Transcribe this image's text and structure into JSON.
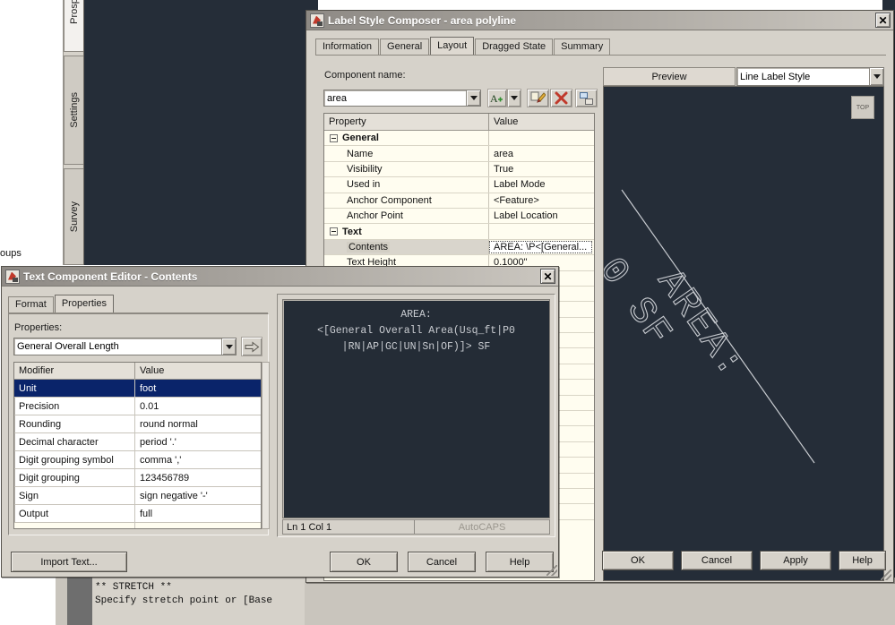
{
  "background": {
    "sidebar_tabs": [
      "Prospe",
      "Settings",
      "Survey"
    ],
    "groups_label": "oups",
    "command_lines": [
      "** STRETCH **",
      "Specify stretch point or [Base"
    ],
    "colors": {
      "acad_canvas": "#252d38",
      "dialog_face": "#d6d2ca",
      "grid_cream": "#fffdf0",
      "selection_blue": "#0a246a"
    }
  },
  "label_style_composer": {
    "title": "Label Style Composer - area polyline",
    "close_label": "✕",
    "tabs": [
      {
        "label": "Information",
        "active": false
      },
      {
        "label": "General",
        "active": false
      },
      {
        "label": "Layout",
        "active": true
      },
      {
        "label": "Dragged State",
        "active": false
      },
      {
        "label": "Summary",
        "active": false
      }
    ],
    "component_name_label": "Component name:",
    "component_name_value": "area",
    "toolbar_icons": [
      "add-component-icon",
      "component-dropdown-arrow-icon",
      "copy-component-icon",
      "delete-component-icon",
      "component-tree-icon"
    ],
    "grid": {
      "headers": [
        "Property",
        "Value"
      ],
      "rows": [
        {
          "type": "category",
          "property": "General",
          "value": ""
        },
        {
          "type": "item",
          "property": "Name",
          "value": "area"
        },
        {
          "type": "item",
          "property": "Visibility",
          "value": "True"
        },
        {
          "type": "item",
          "property": "Used in",
          "value": "Label Mode"
        },
        {
          "type": "item",
          "property": "Anchor Component",
          "value": "<Feature>"
        },
        {
          "type": "item",
          "property": "Anchor Point",
          "value": "Label Location"
        },
        {
          "type": "category",
          "property": "Text",
          "value": ""
        },
        {
          "type": "item",
          "property": "Contents",
          "value": "AREA: \\P<[General...",
          "selected": true,
          "editing": true
        },
        {
          "type": "item",
          "property": "Text Height",
          "value": "0.1000\""
        }
      ],
      "empty_row_count": 16
    },
    "preview": {
      "title": "Preview",
      "style_selector_value": "Line Label Style",
      "ucs_cube_label": "TOP",
      "label_line1": "AREA:",
      "label_line2": "0 SF"
    },
    "buttons": [
      "OK",
      "Cancel",
      "Apply",
      "Help"
    ]
  },
  "text_component_editor": {
    "title": "Text Component Editor - Contents",
    "close_label": "✕",
    "tabs": [
      {
        "label": "Format",
        "active": false
      },
      {
        "label": "Properties",
        "active": true
      }
    ],
    "properties_label": "Properties:",
    "properties_value": "General Overall Length",
    "insert_arrow_icon": "insert-field-arrow-icon",
    "modifier_grid": {
      "headers": [
        "Modifier",
        "Value"
      ],
      "rows": [
        {
          "modifier": "Unit",
          "value": "foot",
          "selected": true
        },
        {
          "modifier": "Precision",
          "value": "0.01"
        },
        {
          "modifier": "Rounding",
          "value": "round normal"
        },
        {
          "modifier": "Decimal character",
          "value": "period '.'"
        },
        {
          "modifier": "Digit grouping symbol",
          "value": "comma ','"
        },
        {
          "modifier": "Digit grouping",
          "value": "123456789"
        },
        {
          "modifier": "Sign",
          "value": "sign negative '-'"
        },
        {
          "modifier": "Output",
          "value": "full"
        },
        {
          "modifier": "",
          "value": ""
        }
      ]
    },
    "editor_text": "AREA:\n<[General Overall Area(Usq_ft|P0\n|RN|AP|GC|UN|Sn|OF)]> SF",
    "status_position": "Ln 1 Col 1",
    "status_autocaps": "AutoCAPS",
    "import_button": "Import Text...",
    "buttons": [
      "OK",
      "Cancel",
      "Help"
    ]
  }
}
